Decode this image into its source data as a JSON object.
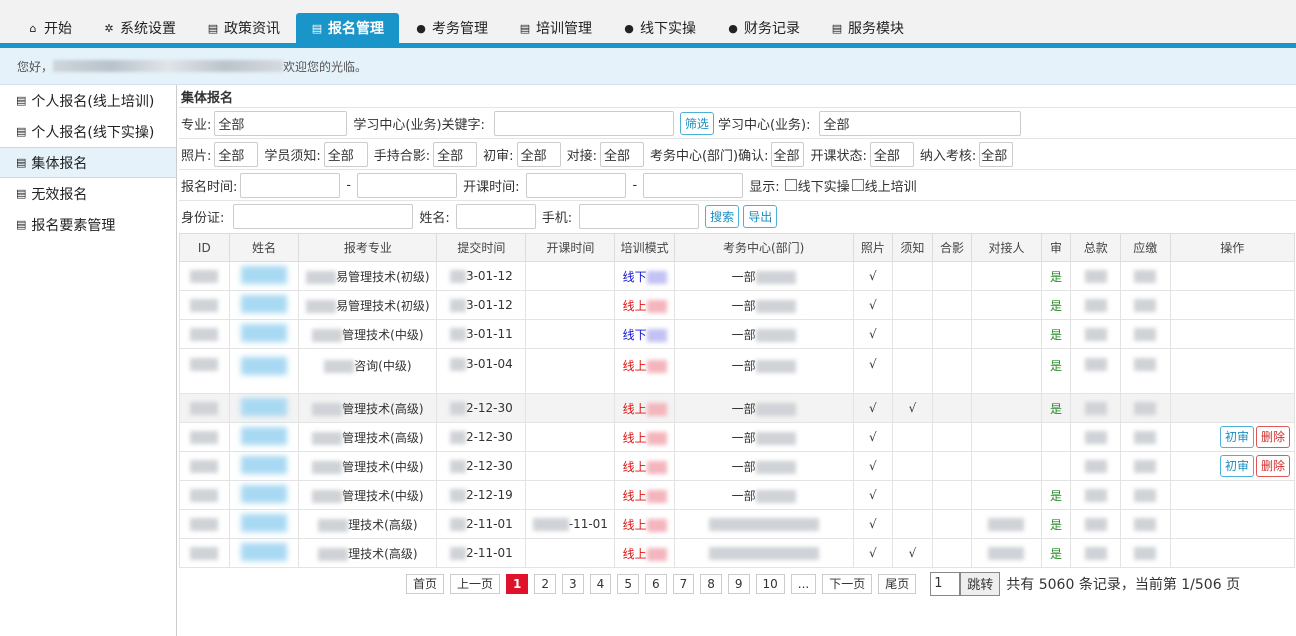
{
  "nav": {
    "tabs": [
      {
        "label": "开始",
        "icon": "home-icon"
      },
      {
        "label": "系统设置",
        "icon": "gear-icon"
      },
      {
        "label": "政策资讯",
        "icon": "document-icon"
      },
      {
        "label": "报名管理",
        "icon": "document-icon"
      },
      {
        "label": "考务管理",
        "icon": "user-icon"
      },
      {
        "label": "培训管理",
        "icon": "document-icon"
      },
      {
        "label": "线下实操",
        "icon": "user-icon"
      },
      {
        "label": "财务记录",
        "icon": "user-icon"
      },
      {
        "label": "服务模块",
        "icon": "document-icon"
      }
    ],
    "active_tab": "报名管理"
  },
  "welcome": {
    "prefix": "您好，",
    "suffix": "欢迎您的光临。"
  },
  "sidebar": {
    "items": [
      {
        "label": "个人报名(线上培训)"
      },
      {
        "label": "个人报名(线下实操)"
      },
      {
        "label": "集体报名"
      },
      {
        "label": "无效报名"
      },
      {
        "label": "报名要素管理"
      }
    ],
    "active": "集体报名"
  },
  "section_title": "集体报名",
  "filters": {
    "major_label": "专业:",
    "major_value": "全部",
    "center_kw_label": "学习中心(业务)关键字:",
    "center_kw_value": "",
    "filter_btn": "筛选",
    "center_label": "学习中心(业务):",
    "center_value": "全部",
    "photo_label": "照片:",
    "photo_value": "全部",
    "notice_label": "学员须知:",
    "notice_value": "全部",
    "hold_label": "手持合影:",
    "hold_value": "全部",
    "first_label": "初审:",
    "first_value": "全部",
    "contact_label": "对接:",
    "contact_value": "全部",
    "dept_label": "考务中心(部门)确认:",
    "dept_value": "全部",
    "class_label": "开课状态:",
    "class_value": "全部",
    "exam_label": "纳入考核:",
    "exam_value": "全部",
    "reg_time_label": "报名时间:",
    "dash1": "-",
    "start_time_label": "开课时间:",
    "dash2": "-",
    "show_label": "显示:",
    "cb1": "线下实操",
    "cb2": "线上培训",
    "id_label": "身份证:",
    "name_label": "姓名:",
    "phone_label": "手机:",
    "search_btn": "搜索",
    "export_btn": "导出"
  },
  "table": {
    "headers": [
      "ID",
      "姓名",
      "报考专业",
      "提交时间",
      "开课时间",
      "培训模式",
      "考务中心(部门)",
      "照片",
      "须知",
      "合影",
      "对接人",
      "审",
      "总款",
      "应缴",
      "操作"
    ],
    "rows": [
      {
        "major": "易管理技术(初级)",
        "submit": "3-01-12",
        "start": "",
        "mode": "线下",
        "mode_color": "off",
        "dept": "一部",
        "photo": "√",
        "notice": "",
        "audit": "是",
        "actions": false,
        "gray": false,
        "tall": false
      },
      {
        "major": "易管理技术(初级)",
        "submit": "3-01-12",
        "start": "",
        "mode": "线上",
        "mode_color": "on",
        "dept": "一部",
        "photo": "√",
        "notice": "",
        "audit": "是",
        "actions": false,
        "gray": false,
        "tall": false
      },
      {
        "major": "管理技术(中级)",
        "submit": "3-01-11",
        "start": "",
        "mode": "线下",
        "mode_color": "off",
        "dept": "一部",
        "photo": "√",
        "notice": "",
        "audit": "是",
        "actions": false,
        "gray": false,
        "tall": false
      },
      {
        "major": "咨询(中级)",
        "submit": "3-01-04",
        "start": "",
        "mode": "线上",
        "mode_color": "on",
        "dept": "一部",
        "photo": "√",
        "notice": "",
        "audit": "是",
        "actions": false,
        "gray": false,
        "tall": true
      },
      {
        "major": "管理技术(高级)",
        "submit": "2-12-30",
        "start": "",
        "mode": "线上",
        "mode_color": "on",
        "dept": "一部",
        "photo": "√",
        "notice": "√",
        "audit": "是",
        "actions": false,
        "gray": true,
        "tall": false
      },
      {
        "major": "管理技术(高级)",
        "submit": "2-12-30",
        "start": "",
        "mode": "线上",
        "mode_color": "on",
        "dept": "一部",
        "photo": "√",
        "notice": "",
        "audit": "",
        "actions": true,
        "gray": false,
        "tall": false
      },
      {
        "major": "管理技术(中级)",
        "submit": "2-12-30",
        "start": "",
        "mode": "线上",
        "mode_color": "on",
        "dept": "一部",
        "photo": "√",
        "notice": "",
        "audit": "",
        "actions": true,
        "gray": false,
        "tall": false
      },
      {
        "major": "管理技术(中级)",
        "submit": "2-12-19",
        "start": "",
        "mode": "线上",
        "mode_color": "on",
        "dept": "一部",
        "photo": "√",
        "notice": "",
        "audit": "是",
        "actions": false,
        "gray": false,
        "tall": false
      },
      {
        "major": "理技术(高级)",
        "submit": "2-11-01",
        "start": "-11-01",
        "mode": "线上",
        "mode_color": "on",
        "dept": "",
        "photo": "√",
        "notice": "",
        "audit": "是",
        "actions": false,
        "gray": false,
        "tall": false
      },
      {
        "major": "理技术(高级)",
        "submit": "2-11-01",
        "start": "",
        "mode": "线上",
        "mode_color": "on",
        "dept": "",
        "photo": "√",
        "notice": "√",
        "audit": "是",
        "actions": false,
        "gray": false,
        "tall": false
      }
    ],
    "action_first": "初审",
    "action_delete": "删除"
  },
  "pager": {
    "first": "首页",
    "prev": "上一页",
    "pages": [
      "1",
      "2",
      "3",
      "4",
      "5",
      "6",
      "7",
      "8",
      "9",
      "10",
      "..."
    ],
    "current": "1",
    "next": "下一页",
    "last": "尾页",
    "jump_value": "1",
    "jump_btn": "跳转",
    "info": "共有 5060 条记录，当前第 1/506 页"
  }
}
